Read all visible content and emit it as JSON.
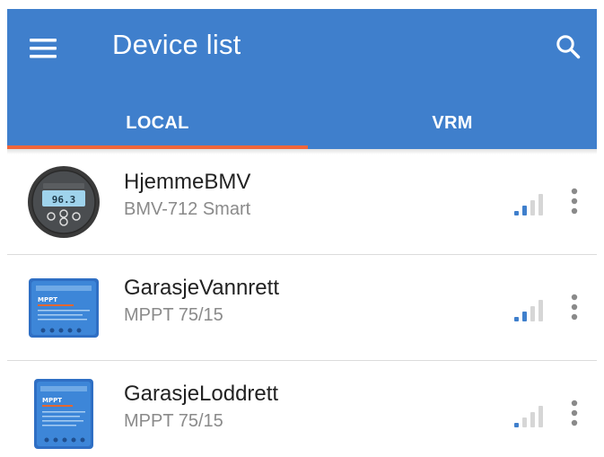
{
  "header": {
    "title": "Device list",
    "menu_icon": "hamburger-menu-icon",
    "search_icon": "search-icon",
    "background_color": "#3f7fcc",
    "text_color": "#ffffff"
  },
  "tabs": [
    {
      "label": "LOCAL",
      "selected": true
    },
    {
      "label": "VRM",
      "selected": false
    }
  ],
  "tab_indicator_color": "#f0663a",
  "devices": [
    {
      "name": "HjemmeBMV",
      "model": "BMV-712 Smart",
      "thumbnail": "battery-monitor-icon",
      "thumbnail_display": "96.3",
      "signal_strength": "2 of 4 bars",
      "more_icon": "more-vertical-icon"
    },
    {
      "name": "GarasjeVannrett",
      "model": "MPPT 75/15",
      "thumbnail": "solar-charger-icon",
      "thumbnail_label": "MPPT",
      "signal_strength": "2 of 4 bars",
      "more_icon": "more-vertical-icon"
    },
    {
      "name": "GarasjeLoddrett",
      "model": "MPPT 75/15",
      "thumbnail": "solar-charger-icon",
      "thumbnail_label": "MPPT",
      "signal_strength": "1 of 4 bars",
      "more_icon": "more-vertical-icon"
    }
  ],
  "colors": {
    "signal_active": "#3f7fcc",
    "signal_inactive": "#d6d6d6",
    "divider": "#dcdcdc",
    "secondary_text": "#8a8a8a"
  }
}
